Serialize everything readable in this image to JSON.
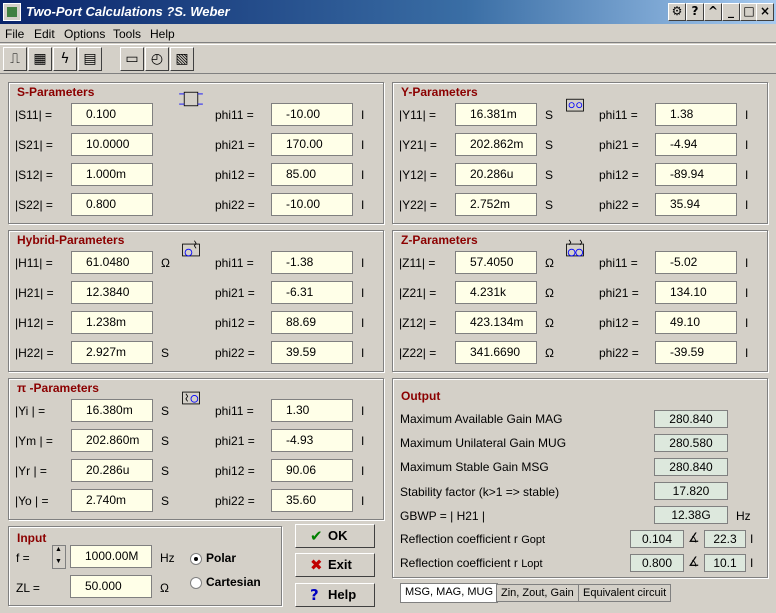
{
  "window": {
    "title": "Two-Port Calculations  ?S. Weber"
  },
  "menu": [
    "File",
    "Edit",
    "Options",
    "Tools",
    "Help"
  ],
  "s": {
    "title": "S-Parameters",
    "rows": [
      {
        "label": "|S11| =",
        "value": "0.100",
        "plabel": "phi11 =",
        "phi": "-10.00"
      },
      {
        "label": "|S21| =",
        "value": "10.0000",
        "plabel": "phi21 =",
        "phi": "170.00"
      },
      {
        "label": "|S12| =",
        "value": "1.000m",
        "plabel": "phi12 =",
        "phi": "85.00"
      },
      {
        "label": "|S22| =",
        "value": "0.800",
        "plabel": "phi22 =",
        "phi": "-10.00"
      }
    ]
  },
  "y": {
    "title": "Y-Parameters",
    "rows": [
      {
        "label": "|Y11| =",
        "value": "16.381m",
        "unit": "S",
        "plabel": "phi11 =",
        "phi": "1.38"
      },
      {
        "label": "|Y21| =",
        "value": "202.862m",
        "unit": "S",
        "plabel": "phi21 =",
        "phi": "-4.94"
      },
      {
        "label": "|Y12| =",
        "value": "20.286u",
        "unit": "S",
        "plabel": "phi12 =",
        "phi": "-89.94"
      },
      {
        "label": "|Y22| =",
        "value": "2.752m",
        "unit": "S",
        "plabel": "phi22 =",
        "phi": "35.94"
      }
    ]
  },
  "h": {
    "title": "Hybrid-Parameters",
    "rows": [
      {
        "label": "|H11| =",
        "value": "61.0480",
        "unit": "Ω",
        "plabel": "phi11 =",
        "phi": "-1.38"
      },
      {
        "label": "|H21| =",
        "value": "12.3840",
        "unit": "",
        "plabel": "phi21 =",
        "phi": "-6.31"
      },
      {
        "label": "|H12| =",
        "value": "1.238m",
        "unit": "",
        "plabel": "phi12 =",
        "phi": "88.69"
      },
      {
        "label": "|H22| =",
        "value": "2.927m",
        "unit": "S",
        "plabel": "phi22 =",
        "phi": "39.59"
      }
    ]
  },
  "z": {
    "title": "Z-Parameters",
    "rows": [
      {
        "label": "|Z11| =",
        "value": "57.4050",
        "unit": "Ω",
        "plabel": "phi11 =",
        "phi": "-5.02"
      },
      {
        "label": "|Z21| =",
        "value": "4.231k",
        "unit": "Ω",
        "plabel": "phi21 =",
        "phi": "134.10"
      },
      {
        "label": "|Z12| =",
        "value": "423.134m",
        "unit": "Ω",
        "plabel": "phi12 =",
        "phi": "49.10"
      },
      {
        "label": "|Z22| =",
        "value": "341.6690",
        "unit": "Ω",
        "plabel": "phi22 =",
        "phi": "-39.59"
      }
    ]
  },
  "pi": {
    "title": "π -Parameters",
    "rows": [
      {
        "label": "|Yi | =",
        "value": "16.380m",
        "unit": "S",
        "plabel": "phi11 =",
        "phi": "1.30"
      },
      {
        "label": "|Ym | =",
        "value": "202.860m",
        "unit": "S",
        "plabel": "phi21 =",
        "phi": "-4.93"
      },
      {
        "label": "|Yr | =",
        "value": "20.286u",
        "unit": "S",
        "plabel": "phi12 =",
        "phi": "90.06"
      },
      {
        "label": "|Yo | =",
        "value": "2.740m",
        "unit": "S",
        "plabel": "phi22 =",
        "phi": "35.60"
      }
    ]
  },
  "output": {
    "title": "Output",
    "mag_label": "Maximum Available Gain MAG",
    "mag": "280.840",
    "mug_label": "Maximum Unilateral Gain MUG",
    "mug": "280.580",
    "msg_label": "Maximum Stable Gain MSG",
    "msg": "280.840",
    "k_label": "Stability factor (k>1 => stable)",
    "k": "17.820",
    "gbwp_label": "GBWP = | H21 |",
    "gbwp": "12.38G",
    "gbwp_unit": "Hz",
    "ropt_label": "Reflection coefficient r",
    "ropt_sub": "Gopt",
    "ropt_mag": "0.104",
    "ropt_ang": "22.3",
    "rlopt_label": "Reflection coefficient r",
    "rlopt_sub": "Lopt",
    "rlopt_mag": "0.800",
    "rlopt_ang": "10.1"
  },
  "input": {
    "title": "Input",
    "f_label": "f =",
    "f": "1000.00M",
    "f_unit": "Hz",
    "zl_label": "ZL =",
    "zl": "50.000",
    "zl_unit": "Ω",
    "polar": "Polar",
    "cartesian": "Cartesian",
    "mode": "polar"
  },
  "buttons": {
    "ok": "OK",
    "exit": "Exit",
    "help": "Help"
  },
  "tabs": [
    "MSG, MAG, MUG",
    "Zin, Zout, Gain",
    "Equivalent circuit"
  ],
  "phi_unit": "I"
}
